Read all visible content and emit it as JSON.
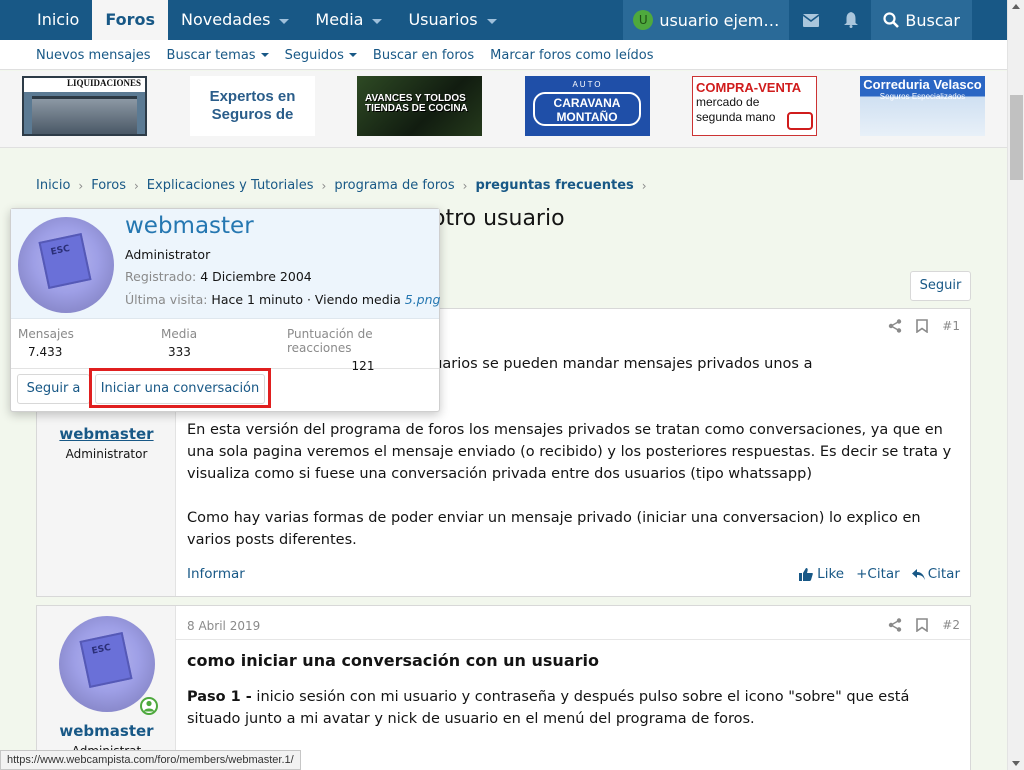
{
  "nav": {
    "tabs": [
      {
        "label": "Inicio"
      },
      {
        "label": "Foros"
      },
      {
        "label": "Novedades"
      },
      {
        "label": "Media"
      },
      {
        "label": "Usuarios"
      }
    ],
    "user": {
      "initial": "U",
      "name": "usuario ejem…"
    },
    "search_label": "Buscar"
  },
  "subnav": {
    "items": [
      "Nuevos mensajes",
      "Buscar temas",
      "Seguidos",
      "Buscar en foros",
      "Marcar foros como leídos"
    ]
  },
  "banners": {
    "b1": "LIQUIDACIONES",
    "b2_line1": "Expertos en",
    "b2_line2": "Seguros de",
    "b3": "AVANCES Y TOLDOS TIENDAS DE COCINA",
    "b4_top": "AUTO",
    "b4_line1": "CARAVANA",
    "b4_line2": "MONTAÑO",
    "b5_title": "COMPRA-VENTA",
    "b5_line1": "mercado de",
    "b5_line2": "segunda mano",
    "b6_title": "Correduria Velasco",
    "b6_sub": "Seguros Especializados"
  },
  "breadcrumb": [
    "Inicio",
    "Foros",
    "Explicaciones y Tutoriales",
    "programa de foros",
    "preguntas frecuentes"
  ],
  "thread": {
    "title_visible": "otro usuario",
    "follow_label": "Seguir"
  },
  "popup": {
    "name": "webmaster",
    "role": "Administrator",
    "registered_label": "Registrado:",
    "registered_value": "4 Diciembre 2004",
    "last_seen_label": "Última visita:",
    "last_seen_value": "Hace 1 minuto · Viendo media",
    "last_seen_link": "5.png",
    "stats": [
      {
        "label": "Mensajes",
        "value": "7.433"
      },
      {
        "label": "Media",
        "value": "333"
      },
      {
        "label": "Puntuación de reacciones",
        "value": "121"
      }
    ],
    "follow_label": "Seguir a",
    "conversation_label": "Iniciar una conversación"
  },
  "post1": {
    "number": "#1",
    "username": "webmaster",
    "usertitle": "Administrator",
    "line_partial": "de foros es que los usuarios se pueden mandar mensajes privados unos a",
    "para2": "En esta versión del programa de foros los mensajes privados se tratan como conversaciones, ya que en una sola pagina veremos el mensaje enviado (o recibido) y los posteriores respuestas. Es decir se trata y visualiza como si fuese una conversación privada entre dos usuarios (tipo whatssapp)",
    "para3": "Como hay varias formas de poder enviar un mensaje privado (iniciar una conversacion) lo explico en varios posts diferentes.",
    "report_label": "Informar",
    "like_label": "Like",
    "quote_label": "+Citar",
    "reply_label": "Citar"
  },
  "post2": {
    "date": "8 Abril 2019",
    "number": "#2",
    "username": "webmaster",
    "usertitle_partial": "Administrat",
    "heading": "como iniciar una conversación con un usuario",
    "step_label": "Paso 1 -",
    "step_text": " inicio sesión con mi usuario y contraseña y después pulso sobre el icono \"sobre\" que está situado junto a mi avatar y nick de usuario en el menú del programa de foros."
  },
  "avatar_text": "ESC",
  "status_url": "https://www.webcampista.com/foro/members/webmaster.1/",
  "colors": {
    "primary": "#185886",
    "accent_red": "#e01f1f",
    "online": "#4ea93d"
  }
}
